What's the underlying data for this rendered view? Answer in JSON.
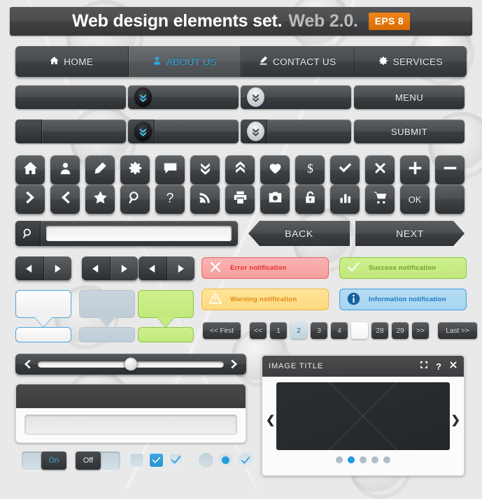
{
  "header": {
    "title_main": "Web design elements set.",
    "title_sub": "Web 2.0.",
    "badge": "EPS 8",
    "badge_color": "#e8790b"
  },
  "nav": {
    "items": [
      {
        "label": "HOME",
        "icon": "home-icon",
        "active": false
      },
      {
        "label": "ABOUT US",
        "icon": "user-icon",
        "active": true
      },
      {
        "label": "CONTACT US",
        "icon": "pencil-icon",
        "active": false
      },
      {
        "label": "SERVICES",
        "icon": "gear-icon",
        "active": false
      }
    ],
    "active_color": "#29abe2"
  },
  "bars": {
    "row1": [
      {
        "label": "",
        "style": "plain"
      },
      {
        "label": "",
        "style": "dropdown-dark"
      },
      {
        "label": "",
        "style": "dropdown-light"
      },
      {
        "label": "MENU",
        "style": "plain"
      }
    ],
    "row2": [
      {
        "label": "",
        "style": "split"
      },
      {
        "label": "",
        "style": "split-dropdown-dark"
      },
      {
        "label": "",
        "style": "split-dropdown-light"
      },
      {
        "label": "SUBMIT",
        "style": "plain"
      }
    ]
  },
  "icon_buttons": {
    "row1": [
      "home-icon",
      "user-icon",
      "pencil-icon",
      "gear-icon",
      "chat-icon",
      "chevron-double-down-icon",
      "chevron-double-up-icon",
      "heart-icon",
      "dollar-icon",
      "check-icon",
      "close-icon",
      "plus-icon",
      "minus-icon"
    ],
    "row2": [
      "chevron-right-icon",
      "chevron-left-icon",
      "star-icon",
      "search-icon",
      "question-icon",
      "rss-icon",
      "printer-icon",
      "camera-icon",
      "lock-icon",
      "bar-chart-icon",
      "cart-icon",
      "ok-label",
      "blank-icon"
    ],
    "ok_label": "OK"
  },
  "search": {
    "value": "",
    "placeholder": "",
    "icon": "search-icon"
  },
  "wizard": {
    "back_label": "BACK",
    "next_label": "NEXT"
  },
  "prev_next_pairs": [
    {
      "prev": "triangle-left-icon",
      "next": "triangle-right-icon"
    },
    {
      "prev": "triangle-left-icon",
      "next": "triangle-right-icon"
    },
    {
      "prev": "triangle-left-icon",
      "next": "triangle-right-icon"
    }
  ],
  "notifications": [
    {
      "type": "error",
      "text": "Error notification",
      "icon": "x-circle-icon",
      "color": "#e2322c",
      "bg": "#f9a8a8"
    },
    {
      "type": "success",
      "text": "Success notification",
      "icon": "check-icon",
      "color": "#6fa02a",
      "bg": "#c6eb82"
    },
    {
      "type": "warning",
      "text": "Warning notification",
      "icon": "warning-icon",
      "color": "#e08b13",
      "bg": "#fdde8c"
    },
    {
      "type": "info",
      "text": "Information notification",
      "icon": "info-icon",
      "color": "#1b79c0",
      "bg": "#abd8f2"
    }
  ],
  "bubbles": [
    {
      "style": "white",
      "tail": true
    },
    {
      "style": "gray",
      "tail": true
    },
    {
      "style": "green",
      "tail": true
    },
    {
      "style": "white",
      "tail": false
    },
    {
      "style": "gray",
      "tail": false
    },
    {
      "style": "green",
      "tail": false
    }
  ],
  "pagination": {
    "first_label": "<< First",
    "prev_label": "<<",
    "next_label": ">>",
    "last_label": "Last >>",
    "pages": [
      "1",
      "2",
      "3",
      "4",
      "",
      "28",
      "29"
    ],
    "active_page": "2"
  },
  "slider": {
    "left_icon": "chevron-left-icon",
    "right_icon": "chevron-right-icon",
    "value_percent": 50
  },
  "form_panel": {
    "header_text": "",
    "input_value": "",
    "input_placeholder": ""
  },
  "image_panel": {
    "title": "IMAGE TITLE",
    "actions": [
      "expand-icon",
      "help-icon",
      "close-icon"
    ],
    "help_label": "?",
    "prev_icon": "chevron-left-icon",
    "next_icon": "chevron-right-icon",
    "dots_count": 5,
    "active_dot": 2
  },
  "toggles": [
    {
      "label": "On",
      "state": "on"
    },
    {
      "label": "Off",
      "state": "off"
    }
  ],
  "checkboxes": [
    {
      "state": "empty"
    },
    {
      "state": "fill"
    },
    {
      "state": "check"
    }
  ],
  "radios": [
    {
      "state": "empty"
    },
    {
      "state": "fill"
    },
    {
      "state": "check"
    }
  ]
}
